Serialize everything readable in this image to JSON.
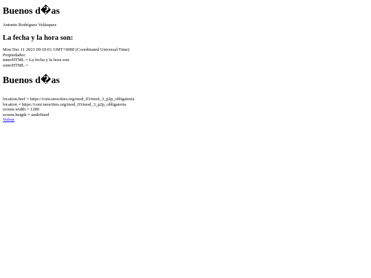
{
  "header": {
    "title": "Buenos d�as",
    "author": "Antonio Rodríguez Velázquez",
    "subtitle": "La fecha y la hora son:"
  },
  "info": {
    "date_line": "Mon Dec 11 2023 09:10:01 GMT+0000 (Coordinated Universal Time)",
    "properties_label": "Propiedades:",
    "inner_html_line": "innerHTML = La fecha y la hora son:",
    "outer_html_line": "outerHTML ="
  },
  "second_title": "Buenos d�as",
  "location": {
    "href_line": "location.href = https://coni.neocities.org/mod_03/mod_3_p2p_obligatoria",
    "location_line": "location = https://coni.neocities.org/mod_03/mod_3_p2p_obligatoria",
    "width_line": "screen.width = 1280",
    "height_line": "screen.heigth = undefined"
  },
  "links": {
    "back_label": "Volver"
  }
}
